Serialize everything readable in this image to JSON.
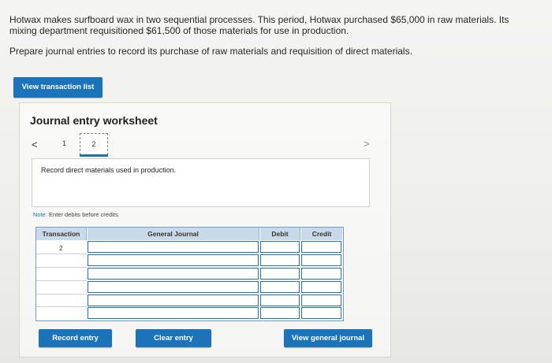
{
  "problem": {
    "paragraph1": "Hotwax makes surfboard wax in two sequential processes. This period, Hotwax purchased $65,000 in raw materials. Its mixing department requisitioned $61,500 of those materials for use in production.",
    "paragraph2": "Prepare journal entries to record its purchase of raw materials and requisition of direct materials."
  },
  "buttons": {
    "view_transaction_list": "View transaction list",
    "record_entry": "Record entry",
    "clear_entry": "Clear entry",
    "view_general_journal": "View general journal"
  },
  "worksheet": {
    "title": "Journal entry worksheet",
    "nav_prev": "<",
    "nav_next": ">",
    "pages": [
      "1",
      "2"
    ],
    "selected_page": "2",
    "description": "Record direct materials used in production.",
    "note_label": "Note:",
    "note_text": "Enter debits before credits."
  },
  "table": {
    "headers": [
      "Transaction",
      "General Journal",
      "Debit",
      "Credit"
    ],
    "rows": [
      {
        "transaction": "2",
        "general_journal": "",
        "debit": "",
        "credit": ""
      },
      {
        "transaction": "",
        "general_journal": "",
        "debit": "",
        "credit": ""
      },
      {
        "transaction": "",
        "general_journal": "",
        "debit": "",
        "credit": ""
      },
      {
        "transaction": "",
        "general_journal": "",
        "debit": "",
        "credit": ""
      },
      {
        "transaction": "",
        "general_journal": "",
        "debit": "",
        "credit": ""
      },
      {
        "transaction": "",
        "general_journal": "",
        "debit": "",
        "credit": ""
      }
    ]
  },
  "colors": {
    "accent": "#1b73ba",
    "header_bg": "#c9d9e8"
  },
  "icons": {
    "prev": "chevron-left-icon",
    "next": "chevron-right-icon"
  }
}
